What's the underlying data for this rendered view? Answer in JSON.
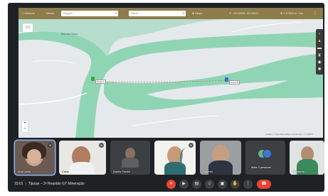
{
  "map": {
    "toolbar": {
      "menu_label": "≡ Relevos",
      "layers_label": "Tabela",
      "search_placeholder": "Origem",
      "filter_placeholder": "Filtrar",
      "nav_label": "◈ Mapa",
      "coords_label": "⊙ -19.92345  -43.93412",
      "zoom_label": "⊕ 1:27500 m / km",
      "menu_icon": "ellipsis-icon"
    },
    "place_label": "Ilha da Ostra",
    "marker_a": {
      "label": "Ponto A",
      "color": "#3aa845"
    },
    "marker_b": {
      "label": "Ponto B",
      "color": "#2d6fc2"
    },
    "attribution": "Leaflet | © OpenStreetMap contributors, © CARTO",
    "zoom_in": "+",
    "zoom_out": "−",
    "colors": {
      "water": "#8fd5b4",
      "land": "#e6e9ec",
      "toolbar": "#8d7c4c",
      "road": "#ffffff"
    }
  },
  "participants": [
    {
      "name": "Ana Lúcia",
      "muted": true,
      "speaking": true
    },
    {
      "name": "Carla",
      "muted": true
    },
    {
      "name": "Danilo Furtes",
      "muted": false
    },
    {
      "name": "",
      "muted": true
    },
    {
      "name": "Roberto",
      "muted": false
    },
    {
      "name": "Mais 2 pessoas",
      "muted": false
    },
    {
      "name": "Leonardo",
      "muted": false
    }
  ],
  "meeting": {
    "time": "15:01",
    "title": "Tijucas – 3ª Reunião GT Mineração"
  },
  "controls": {
    "mic_icon": "mic-off-icon",
    "camera_icon": "camera-icon",
    "captions_icon": "captions-icon",
    "emoji_icon": "emoji-icon",
    "present_icon": "present-icon",
    "hand_icon": "raise-hand-icon",
    "more_icon": "more-options-icon",
    "end_icon": "end-call-icon"
  }
}
